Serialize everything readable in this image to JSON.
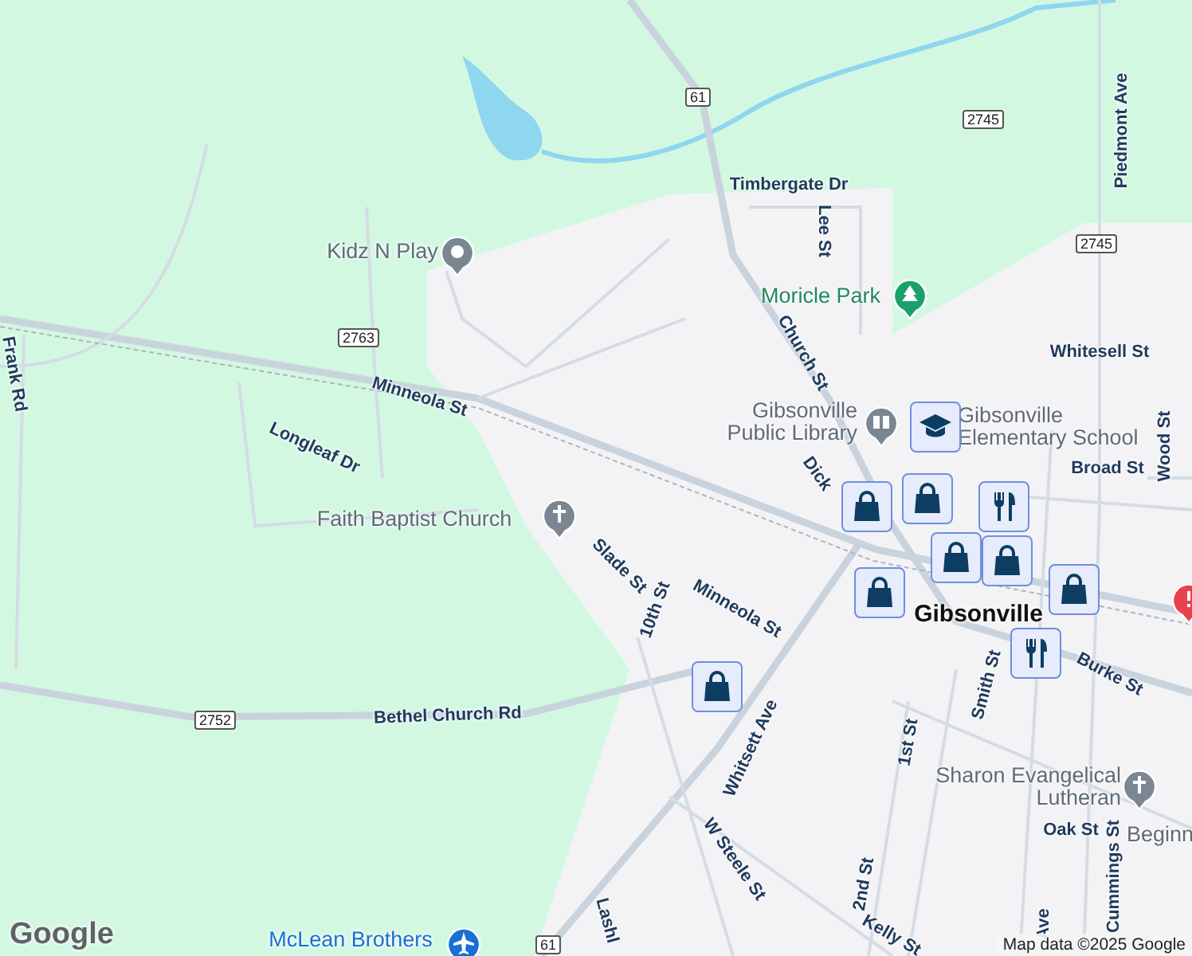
{
  "map": {
    "labels": [
      {
        "text": "Timbergate Dr",
        "kind": "street"
      },
      {
        "text": "Lee St",
        "kind": "street"
      },
      {
        "text": "Piedmont Ave",
        "kind": "street"
      },
      {
        "text": "Moricle Park",
        "kind": "park"
      },
      {
        "text": "Kidz N Play",
        "kind": "place"
      },
      {
        "text": "Church St",
        "kind": "street"
      },
      {
        "text": "Whitesell St",
        "kind": "street"
      },
      {
        "text": "Gibsonville Public Library",
        "kind": "place"
      },
      {
        "text": "Gibsonville Elementary School",
        "kind": "place"
      },
      {
        "text": "Broad St",
        "kind": "street"
      },
      {
        "text": "Wood St",
        "kind": "street"
      },
      {
        "text": "Minneola St",
        "kind": "street"
      },
      {
        "text": "Longleaf Dr",
        "kind": "street"
      },
      {
        "text": "Faith Baptist Church",
        "kind": "place"
      },
      {
        "text": "Slade St",
        "kind": "street"
      },
      {
        "text": "10th St",
        "kind": "street"
      },
      {
        "text": "Minneola St",
        "kind": "street"
      },
      {
        "text": "Frank Rd",
        "kind": "street"
      },
      {
        "text": "Bethel Church Rd",
        "kind": "street"
      },
      {
        "text": "Whitsett Ave",
        "kind": "street"
      },
      {
        "text": "Burke St",
        "kind": "street"
      },
      {
        "text": "Smith St",
        "kind": "street"
      },
      {
        "text": "1st St",
        "kind": "street"
      },
      {
        "text": "Sharon Evangelical Lutheran",
        "kind": "place"
      },
      {
        "text": "Oak St",
        "kind": "street"
      },
      {
        "text": "W Steele St",
        "kind": "street"
      },
      {
        "text": "2nd St",
        "kind": "street"
      },
      {
        "text": "Kelly St",
        "kind": "street"
      },
      {
        "text": "Cummings St",
        "kind": "street"
      },
      {
        "text": "Ave",
        "kind": "street"
      },
      {
        "text": "Lashl",
        "kind": "street"
      },
      {
        "text": "McLean Brothers",
        "kind": "airport"
      },
      {
        "text": "Beginn",
        "kind": "place"
      },
      {
        "text": "Dick",
        "kind": "street"
      },
      {
        "text": "Gibsonville",
        "kind": "town"
      }
    ],
    "shields": [
      "61",
      "2745",
      "2745",
      "2763",
      "2752",
      "61"
    ],
    "pois": [
      {
        "kind": "place"
      },
      {
        "kind": "park"
      },
      {
        "kind": "library"
      },
      {
        "kind": "church"
      },
      {
        "kind": "church"
      },
      {
        "kind": "airport"
      },
      {
        "kind": "alert"
      }
    ],
    "markers": [
      {
        "kind": "school"
      },
      {
        "kind": "shop"
      },
      {
        "kind": "shop"
      },
      {
        "kind": "food"
      },
      {
        "kind": "shop"
      },
      {
        "kind": "shop"
      },
      {
        "kind": "shop"
      },
      {
        "kind": "food"
      },
      {
        "kind": "shop"
      },
      {
        "kind": "shop"
      }
    ],
    "logo": "Google",
    "attribution": "Map data ©2025 Google"
  }
}
